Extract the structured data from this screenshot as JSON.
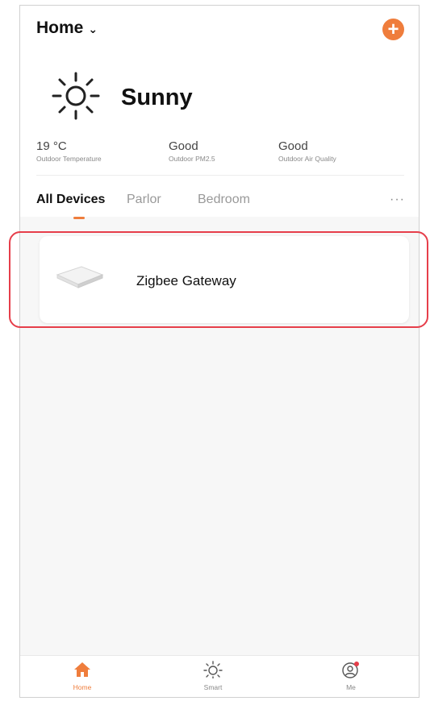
{
  "header": {
    "home_label": "Home",
    "add_icon": "plus-circle-icon",
    "accent_color": "#ef7d3c"
  },
  "weather": {
    "condition": "Sunny",
    "icon": "sun-icon",
    "stats": [
      {
        "value": "19 °C",
        "label": "Outdoor Temperature"
      },
      {
        "value": "Good",
        "label": "Outdoor PM2.5"
      },
      {
        "value": "Good",
        "label": "Outdoor Air Quality"
      }
    ]
  },
  "tabs": {
    "items": [
      "All Devices",
      "Parlor",
      "Bedroom"
    ],
    "active": "All Devices",
    "more": "···"
  },
  "devices": [
    {
      "name": "Zigbee Gateway",
      "icon": "gateway-icon"
    }
  ],
  "bottom_nav": {
    "items": [
      {
        "label": "Home",
        "icon": "home-icon",
        "active": true
      },
      {
        "label": "Smart",
        "icon": "sun-icon",
        "active": false
      },
      {
        "label": "Me",
        "icon": "profile-icon",
        "active": false
      }
    ]
  }
}
